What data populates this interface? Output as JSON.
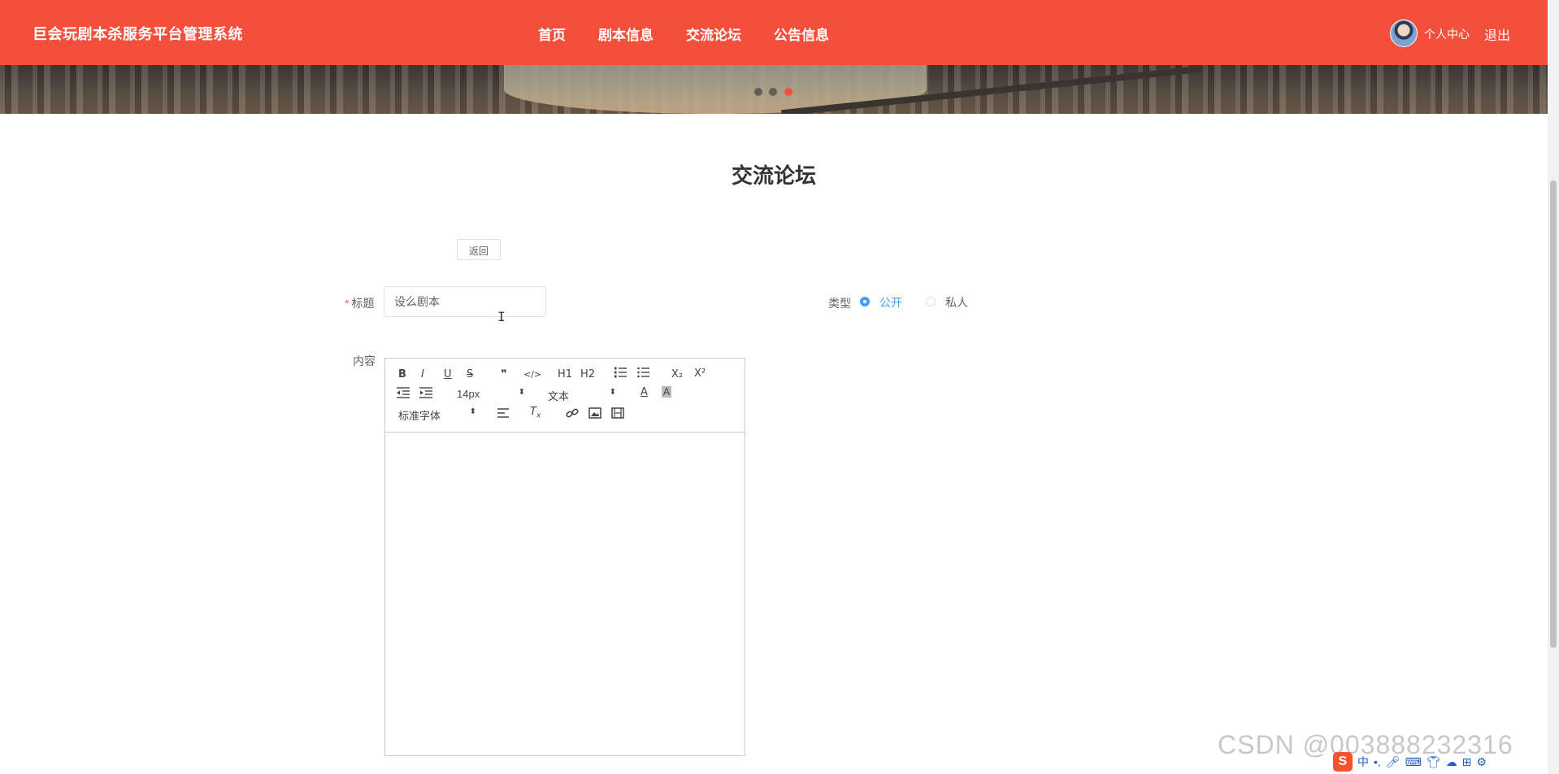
{
  "header": {
    "brand": "巨会玩剧本杀服务平台管理系统",
    "nav": [
      "首页",
      "剧本信息",
      "交流论坛",
      "公告信息"
    ],
    "user_center": "个人中心",
    "logout": "退出"
  },
  "page": {
    "title": "交流论坛",
    "back_button": "返回"
  },
  "form": {
    "title_label": "标题",
    "title_required_mark": "*",
    "title_value": "设么剧本",
    "type_label": "类型",
    "type_options": [
      "公开",
      "私人"
    ],
    "type_selected": "公开",
    "content_label": "内容"
  },
  "editor_toolbar": {
    "bold": "B",
    "italic": "I",
    "underline": "U",
    "strike": "S",
    "blockquote": "❞",
    "code": "</>",
    "h1": "H1",
    "h2": "H2",
    "subscript": "X₂",
    "superscript": "X²",
    "size": "14px",
    "header_select": "文本",
    "font_select": "标准字体"
  },
  "watermark": "CSDN @003888232316",
  "ime": {
    "lang": "中",
    "punct": "•,"
  },
  "colors": {
    "brand": "#f44f3b",
    "accent": "#409eff"
  }
}
